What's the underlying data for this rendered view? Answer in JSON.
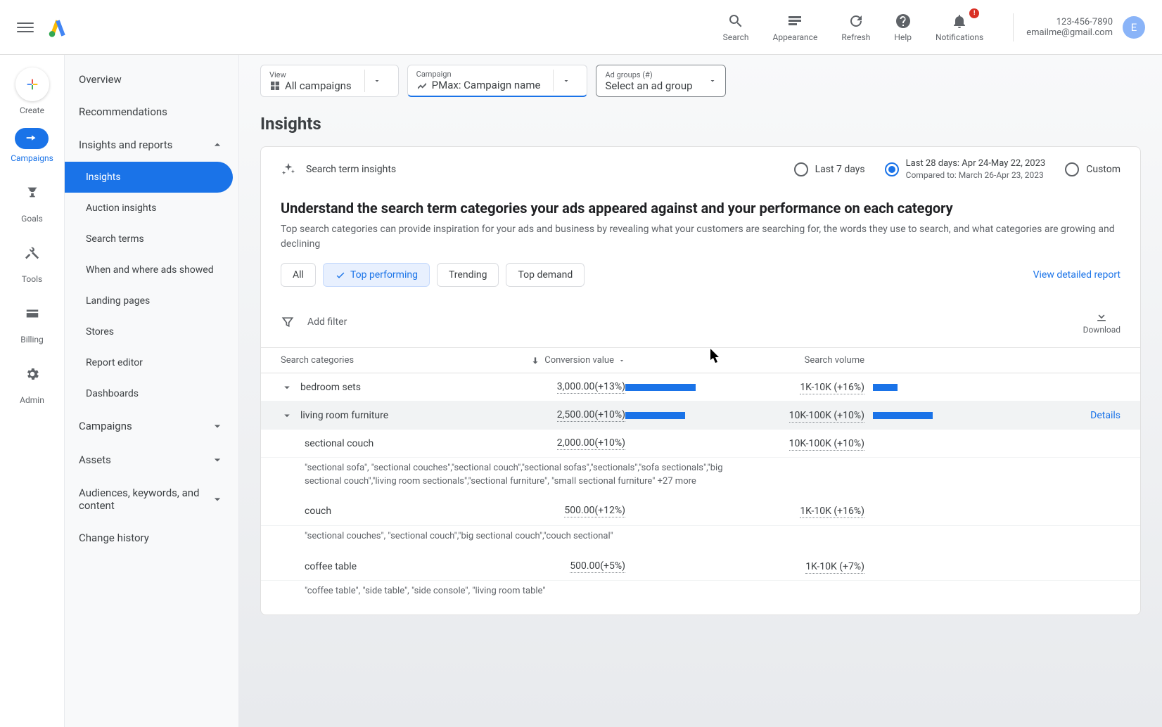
{
  "header": {
    "actions": {
      "search": "Search",
      "appearance": "Appearance",
      "refresh": "Refresh",
      "help": "Help",
      "notifications": "Notifications",
      "notif_badge": "!"
    },
    "account": {
      "id": "123-456-7890",
      "email": "emailme@gmail.com",
      "avatar_letter": "E"
    }
  },
  "rail": {
    "create": "Create",
    "campaigns": "Campaigns",
    "goals": "Goals",
    "tools": "Tools",
    "billing": "Billing",
    "admin": "Admin"
  },
  "sidebar": {
    "overview": "Overview",
    "recommendations": "Recommendations",
    "insights_reports": "Insights and reports",
    "insights": "Insights",
    "auction": "Auction insights",
    "search_terms": "Search terms",
    "when_where": "When and where ads showed",
    "landing": "Landing pages",
    "stores": "Stores",
    "report_editor": "Report editor",
    "dashboards": "Dashboards",
    "campaigns": "Campaigns",
    "assets": "Assets",
    "audiences": "Audiences, keywords, and content",
    "change_history": "Change history"
  },
  "scope": {
    "view_label": "View",
    "view_value": "All campaigns",
    "campaign_label": "Campaign",
    "campaign_value": "PMax: Campaign name",
    "adgroup_label": "Ad groups (#)",
    "adgroup_value": "Select an ad group"
  },
  "page": {
    "title": "Insights"
  },
  "card": {
    "top_label": "Search term insights",
    "date_last7": "Last 7 days",
    "date_last28": "Last 28 days: Apr 24-May 22, 2023",
    "date_compared": "Compared to: March 26-Apr 23, 2023",
    "date_custom": "Custom",
    "heading": "Understand the search term categories your ads appeared against and your performance on each category",
    "description": "Top search categories can provide inspiration for your ads and business by revealing what your customers are searching for, the words they use to search, and what categories are growing and declining",
    "chips": {
      "all": "All",
      "top_perf": "Top performing",
      "trending": "Trending",
      "top_demand": "Top demand"
    },
    "view_report": "View detailed report",
    "filter_placeholder": "Add filter",
    "download": "Download",
    "columns": {
      "cat": "Search categories",
      "conv": "Conversion value",
      "search": "Search volume"
    },
    "details": "Details"
  },
  "rows": {
    "r1": {
      "cat": "bedroom sets",
      "conv": "3,000.00(+13%)",
      "search": "1K-10K (+16%)"
    },
    "r2": {
      "cat": "living room furniture",
      "conv": "2,500.00(+10%)",
      "search": "10K-100K (+10%)"
    },
    "r3": {
      "cat": "sectional couch",
      "conv": "2,000.00(+10%)",
      "search": "10K-100K (+10%)",
      "terms": "\"sectional sofa\", \"sectional couches\",\"sectional couch\",\"sectional sofas\",\"sectionals\",\"sofa sectionals\",\"big sectional couch\",\"living room sectionals\",\"sectional furniture\", \"small sectional furniture\" +27 more"
    },
    "r4": {
      "cat": "couch",
      "conv": "500.00(+12%)",
      "search": "1K-10K (+16%)",
      "terms": "\"sectional couches\", \"sectional couch\",\"big sectional couch\",\"couch sectional\""
    },
    "r5": {
      "cat": "coffee table",
      "conv": "500.00(+5%)",
      "search": "1K-10K (+7%)",
      "terms": "\"coffee table\", \"side table\", \"side console\", \"living room table\""
    }
  }
}
